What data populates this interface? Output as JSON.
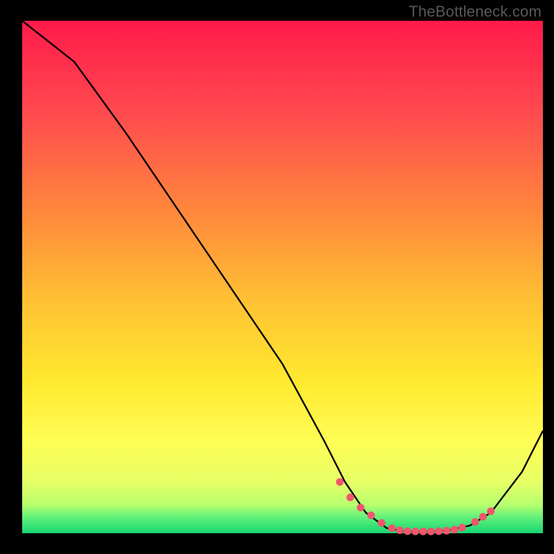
{
  "watermark": "TheBottleneck.com",
  "colors": {
    "black": "#000000",
    "line": "#000000",
    "marker": "#f0566c",
    "gradient_stops": [
      {
        "offset": 0.0,
        "color": "#ff1a4a"
      },
      {
        "offset": 0.18,
        "color": "#ff4a4f"
      },
      {
        "offset": 0.38,
        "color": "#ff8a3b"
      },
      {
        "offset": 0.55,
        "color": "#ffc233"
      },
      {
        "offset": 0.7,
        "color": "#ffe82f"
      },
      {
        "offset": 0.82,
        "color": "#fffd55"
      },
      {
        "offset": 0.9,
        "color": "#e6ff66"
      },
      {
        "offset": 0.945,
        "color": "#b7ff6e"
      },
      {
        "offset": 0.97,
        "color": "#5ef07a"
      },
      {
        "offset": 1.0,
        "color": "#17d673"
      }
    ]
  },
  "chart_data": {
    "type": "line",
    "title": "",
    "xlabel": "",
    "ylabel": "",
    "xlim": [
      0,
      100
    ],
    "ylim": [
      0,
      100
    ],
    "series": [
      {
        "name": "curve",
        "x": [
          0,
          5,
          10,
          20,
          30,
          40,
          50,
          58,
          62,
          66,
          70,
          74,
          78,
          82,
          86,
          90,
          96,
          100
        ],
        "y": [
          100,
          96,
          92,
          78,
          63,
          48,
          33,
          18,
          10,
          4,
          1,
          0.3,
          0.3,
          0.6,
          1.5,
          4,
          12,
          20
        ]
      }
    ],
    "markers": {
      "name": "dotted-band",
      "x": [
        61,
        63,
        65,
        67,
        69,
        71,
        72.5,
        74,
        75.5,
        77,
        78.5,
        80,
        81.5,
        83,
        84.5,
        87,
        88.5,
        90
      ],
      "y": [
        10,
        7,
        5,
        3.5,
        2,
        1,
        0.6,
        0.4,
        0.35,
        0.35,
        0.35,
        0.4,
        0.5,
        0.7,
        1.1,
        2.2,
        3.2,
        4.3
      ]
    }
  }
}
